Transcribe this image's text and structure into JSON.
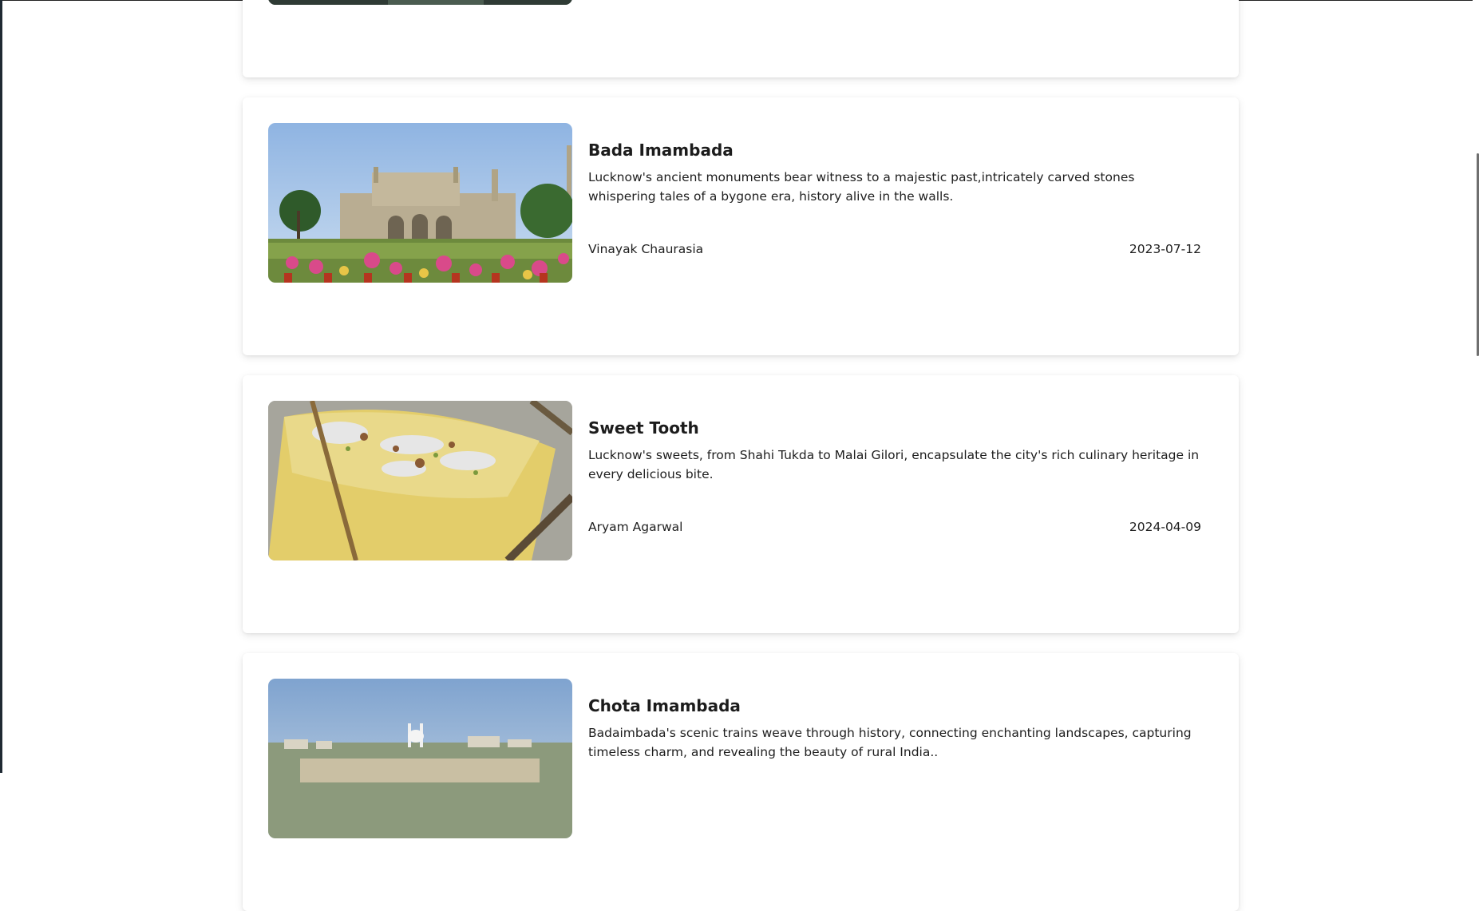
{
  "posts": [
    {
      "title": "",
      "description": "",
      "author": "",
      "date": "",
      "image_icon": "top-cropped-photo"
    },
    {
      "title": "Bada Imambada",
      "description": "Lucknow's ancient monuments bear witness to a majestic past,intricately carved stones whispering tales of a bygone era, history alive in the walls.",
      "author": "Vinayak Chaurasia",
      "date": "2023-07-12",
      "image_icon": "monument-photo"
    },
    {
      "title": "Sweet Tooth",
      "description": "Lucknow's sweets, from Shahi Tukda to Malai Gilori, encapsulate the city's rich culinary heritage in every delicious bite.",
      "author": "Aryam Agarwal",
      "date": "2024-04-09",
      "image_icon": "sweets-photo"
    },
    {
      "title": "Chota Imambada",
      "description": "Badaimbada's scenic trains weave through history, connecting enchanting landscapes, capturing timeless charm, and revealing the beauty of rural India..",
      "author": "",
      "date": "",
      "image_icon": "cityscape-photo"
    }
  ]
}
